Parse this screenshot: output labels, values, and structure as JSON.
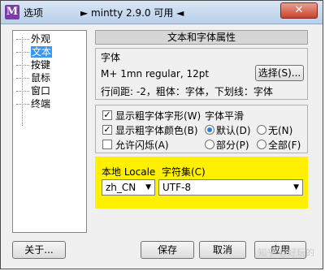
{
  "window": {
    "title": "选项",
    "app_title": "► mintty 2.9.0 可用 ◄",
    "close_label": "✕"
  },
  "tree": {
    "items": [
      "外观",
      "文本",
      "按键",
      "鼠标",
      "窗口",
      "终端"
    ],
    "selected": "文本"
  },
  "panel": {
    "header": "文本和字体属性"
  },
  "font": {
    "label": "字体",
    "value": "M+ 1mn regular, 12pt",
    "select_button": "选择(S)...",
    "details": "行间距: -2，粗体：字体，下划线：字体"
  },
  "bold": {
    "as_font_label": "显示粗字体字形(W)",
    "as_font_checked": true,
    "as_colour_label": "显示粗字体颜色(B)",
    "as_colour_checked": true,
    "allow_blink_label": "允许闪烁(A)",
    "allow_blink_checked": false
  },
  "smoothing": {
    "label": "字体平滑",
    "options": [
      "默认(D)",
      "无(N)",
      "部分(P)",
      "全部(F)"
    ],
    "selected": "默认(D)"
  },
  "locale": {
    "locale_label": "本地 Locale",
    "charset_label": "字符集(C)",
    "locale_value": "zh_CN",
    "charset_value": "UTF-8",
    "highlight_color": "#fff000"
  },
  "buttons": {
    "about": "关于...",
    "save": "保存",
    "cancel": "取消",
    "apply": "应用"
  },
  "watermark": "知乎 @好玩的 "
}
